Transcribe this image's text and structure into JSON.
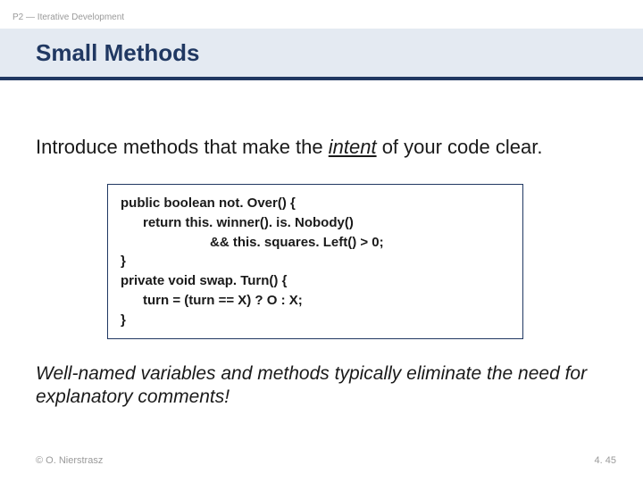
{
  "breadcrumb": "P2 — Iterative Development",
  "title": "Small Methods",
  "lead_before": "Introduce methods that make the ",
  "lead_emph": "intent",
  "lead_after": " of your code clear.",
  "code": {
    "l1": "public boolean not. Over() {",
    "l2": "      return this. winner(). is. Nobody()",
    "l3": "                        && this. squares. Left() > 0;",
    "l4": "}",
    "l5": "private void swap. Turn() {",
    "l6": "      turn = (turn == X) ? O : X;",
    "l7": "}"
  },
  "conclusion": "Well-named variables and methods typically eliminate the need for explanatory comments!",
  "copyright": "© O. Nierstrasz",
  "page_num": "4. 45"
}
